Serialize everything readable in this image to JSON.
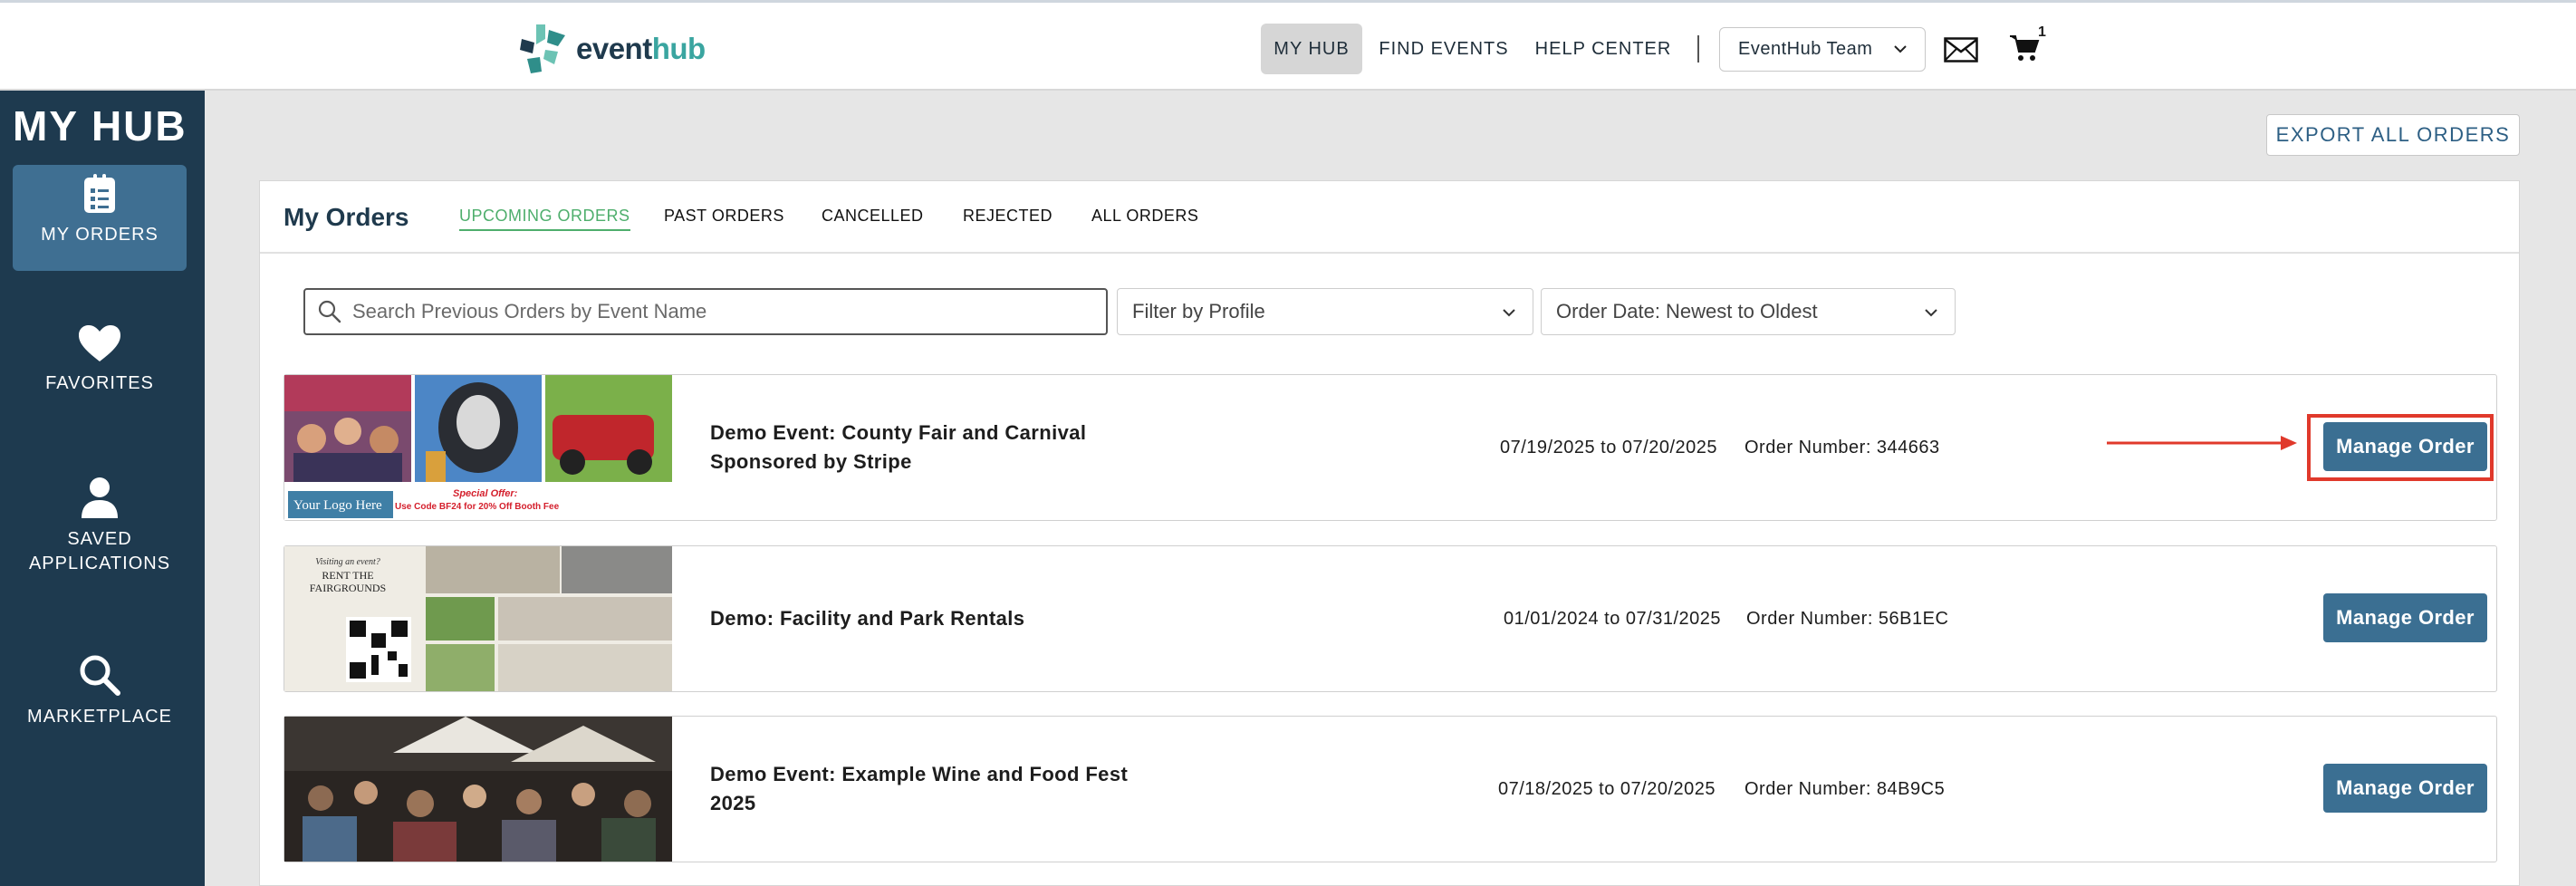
{
  "brand": {
    "logo_part1": "event",
    "logo_part2": "hub",
    "logo_colors": [
      "#2f8e8a",
      "#1f3a4d",
      "#6cc3b4"
    ]
  },
  "topnav": {
    "items": [
      "MY HUB",
      "FIND EVENTS",
      "HELP CENTER"
    ],
    "active": "MY HUB",
    "team_selector": "EventHub Team",
    "cart_count": "1",
    "icons": [
      "mail-icon",
      "cart-icon",
      "chevron-down-icon"
    ]
  },
  "sidebar": {
    "title": "MY HUB",
    "items": [
      {
        "label": "MY ORDERS",
        "icon": "clipboard-icon",
        "active": true
      },
      {
        "label": "FAVORITES",
        "icon": "heart-icon",
        "active": false
      },
      {
        "label": "SAVED\nAPPLICATIONS",
        "line1": "SAVED",
        "line2": "APPLICATIONS",
        "icon": "user-icon",
        "active": false
      },
      {
        "label": "MARKETPLACE",
        "icon": "search-icon",
        "active": false
      }
    ]
  },
  "actions": {
    "export_label": "EXPORT ALL ORDERS"
  },
  "orders_panel": {
    "title": "My Orders",
    "tabs": [
      "UPCOMING ORDERS",
      "PAST ORDERS",
      "CANCELLED",
      "REJECTED",
      "ALL ORDERS"
    ],
    "active_tab": "UPCOMING ORDERS",
    "search_placeholder": "Search Previous Orders by Event Name",
    "profile_filter": "Filter by Profile",
    "sort": "Order Date: Newest to Oldest"
  },
  "orders": [
    {
      "name": "Demo Event: County Fair and Carnival Sponsored by Stripe",
      "dates": "07/19/2025 to 07/20/2025",
      "order_number": "Order Number: 344663",
      "button": "Manage Order",
      "thumb_text": {
        "logo": "Your Logo Here",
        "offer": "Special Offer:",
        "code": "Use Code BF24 for 20% Off Booth Fee"
      }
    },
    {
      "name": "Demo: Facility and Park Rentals",
      "dates": "01/01/2024 to 07/31/2025",
      "order_number": "Order Number: 56B1EC",
      "button": "Manage Order",
      "thumb_text": {
        "line1": "Visiting an event?",
        "line2": "RENT THE",
        "line3": "FAIRGROUNDS"
      }
    },
    {
      "name": "Demo Event: Example Wine and Food Fest 2025",
      "dates": "07/18/2025 to 07/20/2025",
      "order_number": "Order Number: 84B9C5",
      "button": "Manage Order"
    }
  ],
  "annotation": {
    "highlight_color": "#e0392b"
  }
}
